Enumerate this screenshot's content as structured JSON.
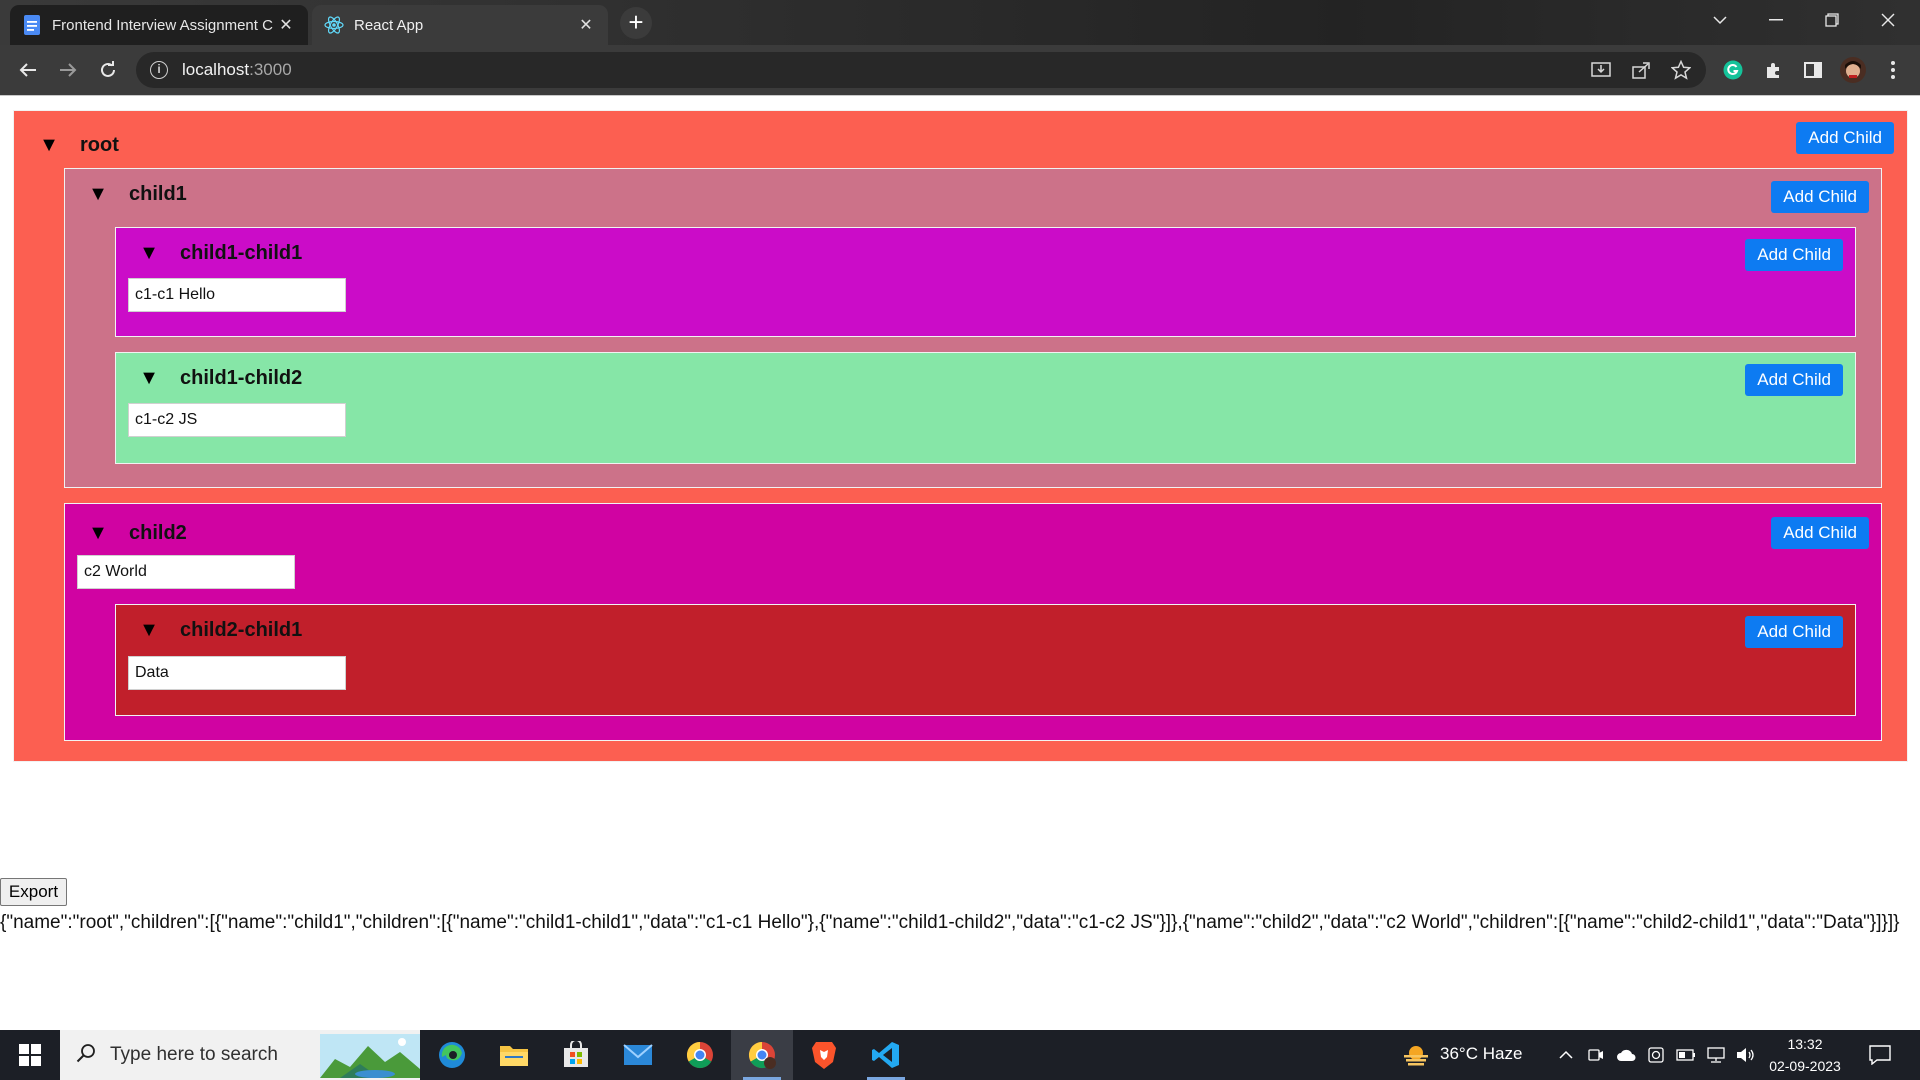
{
  "browser": {
    "tabs": [
      {
        "title": "Frontend Interview Assignment C",
        "icon": "docs-icon",
        "active": false
      },
      {
        "title": "React App",
        "icon": "react-icon",
        "active": true
      }
    ],
    "address_host": "localhost",
    "address_port": ":3000"
  },
  "tree": {
    "root": {
      "name": "root",
      "toggle": "▼",
      "add_label": "Add Child",
      "color": "#fc5f51"
    },
    "child1": {
      "name": "child1",
      "toggle": "▼",
      "add_label": "Add Child",
      "color": "#cc7289"
    },
    "child1_child1": {
      "name": "child1-child1",
      "toggle": "▼",
      "add_label": "Add Child",
      "data": "c1-c1 Hello",
      "color": "#cb0cc8"
    },
    "child1_child2": {
      "name": "child1-child2",
      "toggle": "▼",
      "add_label": "Add Child",
      "data": "c1-c2 JS",
      "color": "#86e6a7"
    },
    "child2": {
      "name": "child2",
      "toggle": "▼",
      "add_label": "Add Child",
      "data": "c2 World",
      "color": "#d003a2"
    },
    "child2_child1": {
      "name": "child2-child1",
      "toggle": "▼",
      "add_label": "Add Child",
      "data": "Data",
      "color": "#c11f2b"
    }
  },
  "export": {
    "label": "Export",
    "output": "{\"name\":\"root\",\"children\":[{\"name\":\"child1\",\"children\":[{\"name\":\"child1-child1\",\"data\":\"c1-c1 Hello\"},{\"name\":\"child1-child2\",\"data\":\"c1-c2 JS\"}]},{\"name\":\"child2\",\"data\":\"c2 World\",\"children\":[{\"name\":\"child2-child1\",\"data\":\"Data\"}]}]}"
  },
  "taskbar": {
    "search_placeholder": "Type here to search",
    "weather": "36°C  Haze",
    "time": "13:32",
    "date": "02-09-2023"
  }
}
